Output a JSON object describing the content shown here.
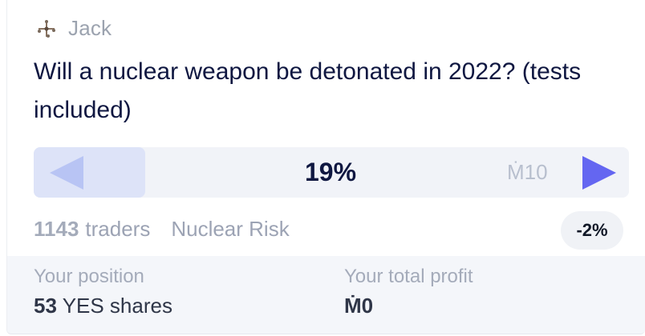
{
  "creator": {
    "name": "Jack",
    "icon": "creator-avatar-icon"
  },
  "question": "Will a nuclear weapon be detonated in 2022? (tests included)",
  "trade": {
    "no_icon": "left-triangle-icon",
    "yes_icon": "right-triangle-icon",
    "probability": "19%",
    "bet_amount": "Ṁ10",
    "colors": {
      "no_bg": "#dde3f8",
      "no_arrow": "#b8c4f4",
      "yes_arrow": "#6466f1"
    }
  },
  "stats": {
    "traders_count": "1143",
    "traders_label": "traders",
    "group": "Nuclear Risk",
    "change": "-2%"
  },
  "position": {
    "label": "Your position",
    "shares_count": "53",
    "shares_label": "YES shares",
    "profit_label": "Your total profit",
    "profit_value": "Ṁ0"
  }
}
